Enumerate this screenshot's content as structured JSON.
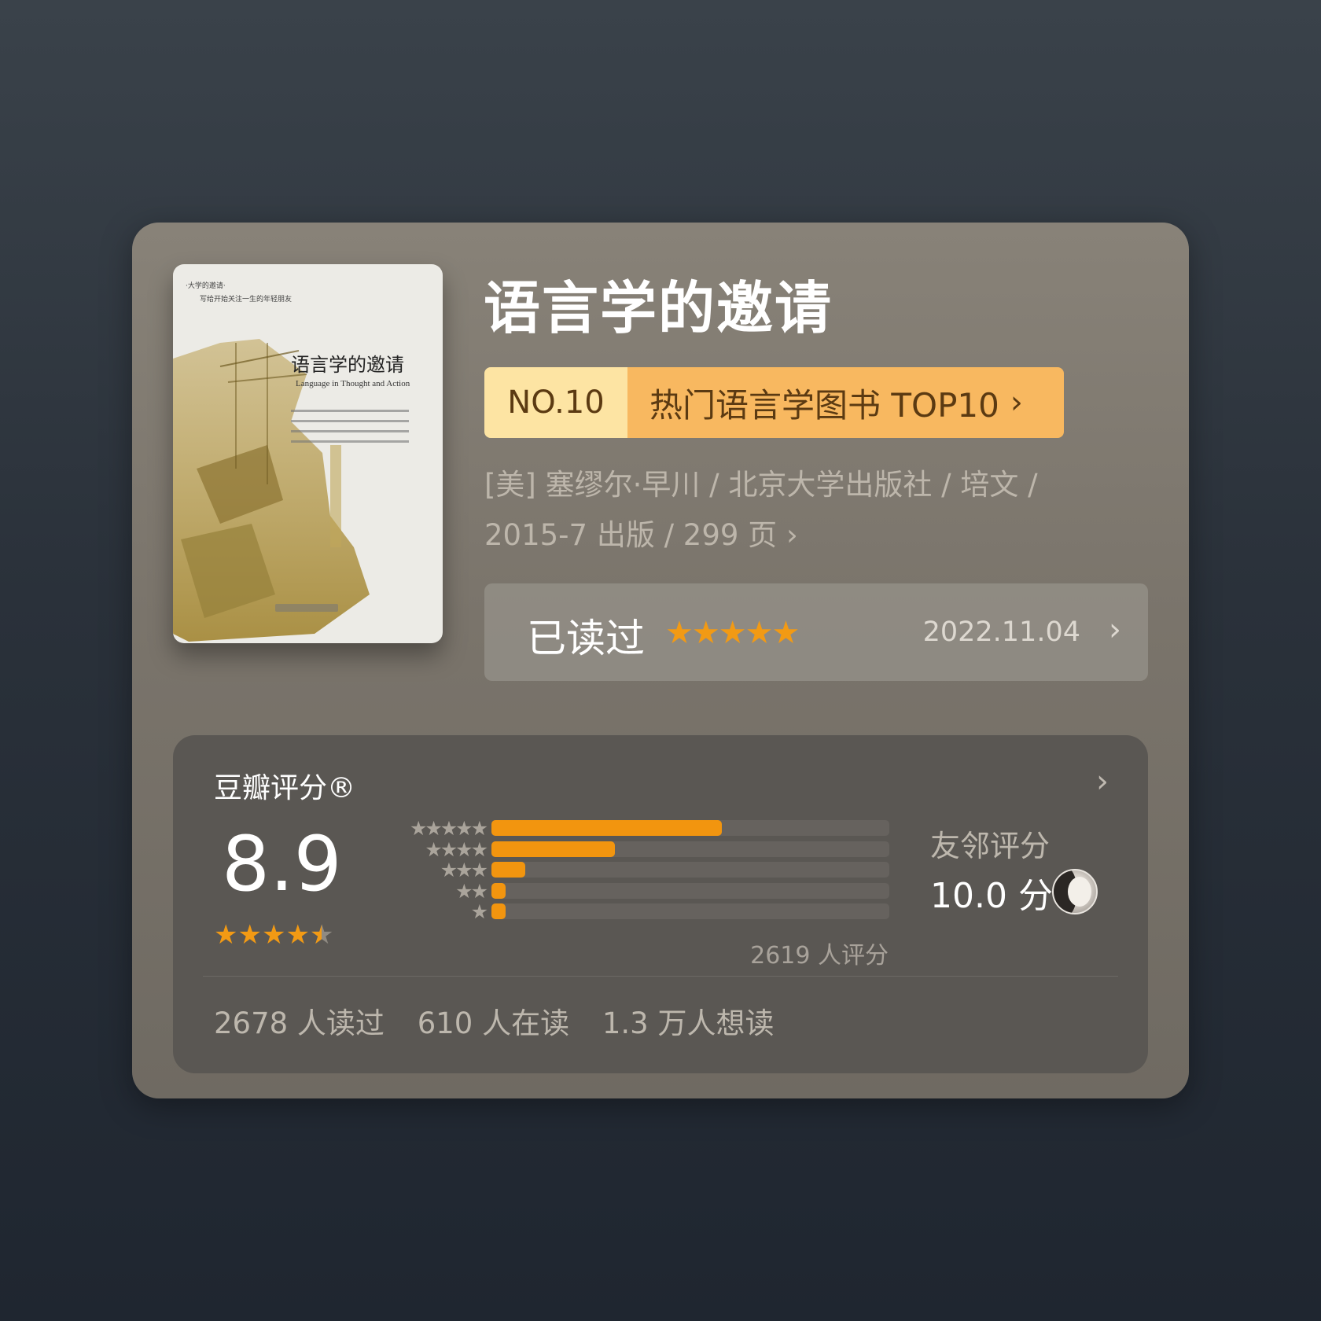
{
  "book": {
    "title": "语言学的邀请",
    "cover": {
      "series": "·大学的邀请·",
      "motto": "写给开始关注一生的年轻朋友",
      "title": "语言学的邀请",
      "subtitle": "Language in Thought and Action"
    },
    "rank": {
      "no": "NO.10",
      "label": "热门语言学图书 TOP10",
      "chevron": "›"
    },
    "meta_line1": "[美] 塞缪尔·早川 / 北京大学出版社 / 培文 /",
    "meta_line2": "2015-7 出版 / 299 页 ›"
  },
  "my_reading": {
    "status": "已读过",
    "my_rating_stars": 5,
    "stars_text": "★★★★★",
    "date": "2022.11.04",
    "chevron": "›"
  },
  "rating": {
    "header": "豆瓣评分®",
    "chevron": "›",
    "score": "8.9",
    "score_stars": 4.5,
    "distribution": [
      {
        "stars": "★★★★★",
        "fraction": 0.58
      },
      {
        "stars": "★★★★",
        "fraction": 0.31
      },
      {
        "stars": "★★★",
        "fraction": 0.085
      },
      {
        "stars": "★★",
        "fraction": 0.035
      },
      {
        "stars": "★",
        "fraction": 0.035
      }
    ],
    "count": "2619 人评分",
    "friend_label": "友邻评分",
    "friend_score": "10.0 分",
    "stats": {
      "read": "2678 人读过",
      "reading": "610 人在读",
      "want": "1.3 万人想读"
    }
  },
  "colors": {
    "accent": "#f2950f",
    "rank_left": "#fde4a3",
    "rank_right": "#f8b860"
  }
}
